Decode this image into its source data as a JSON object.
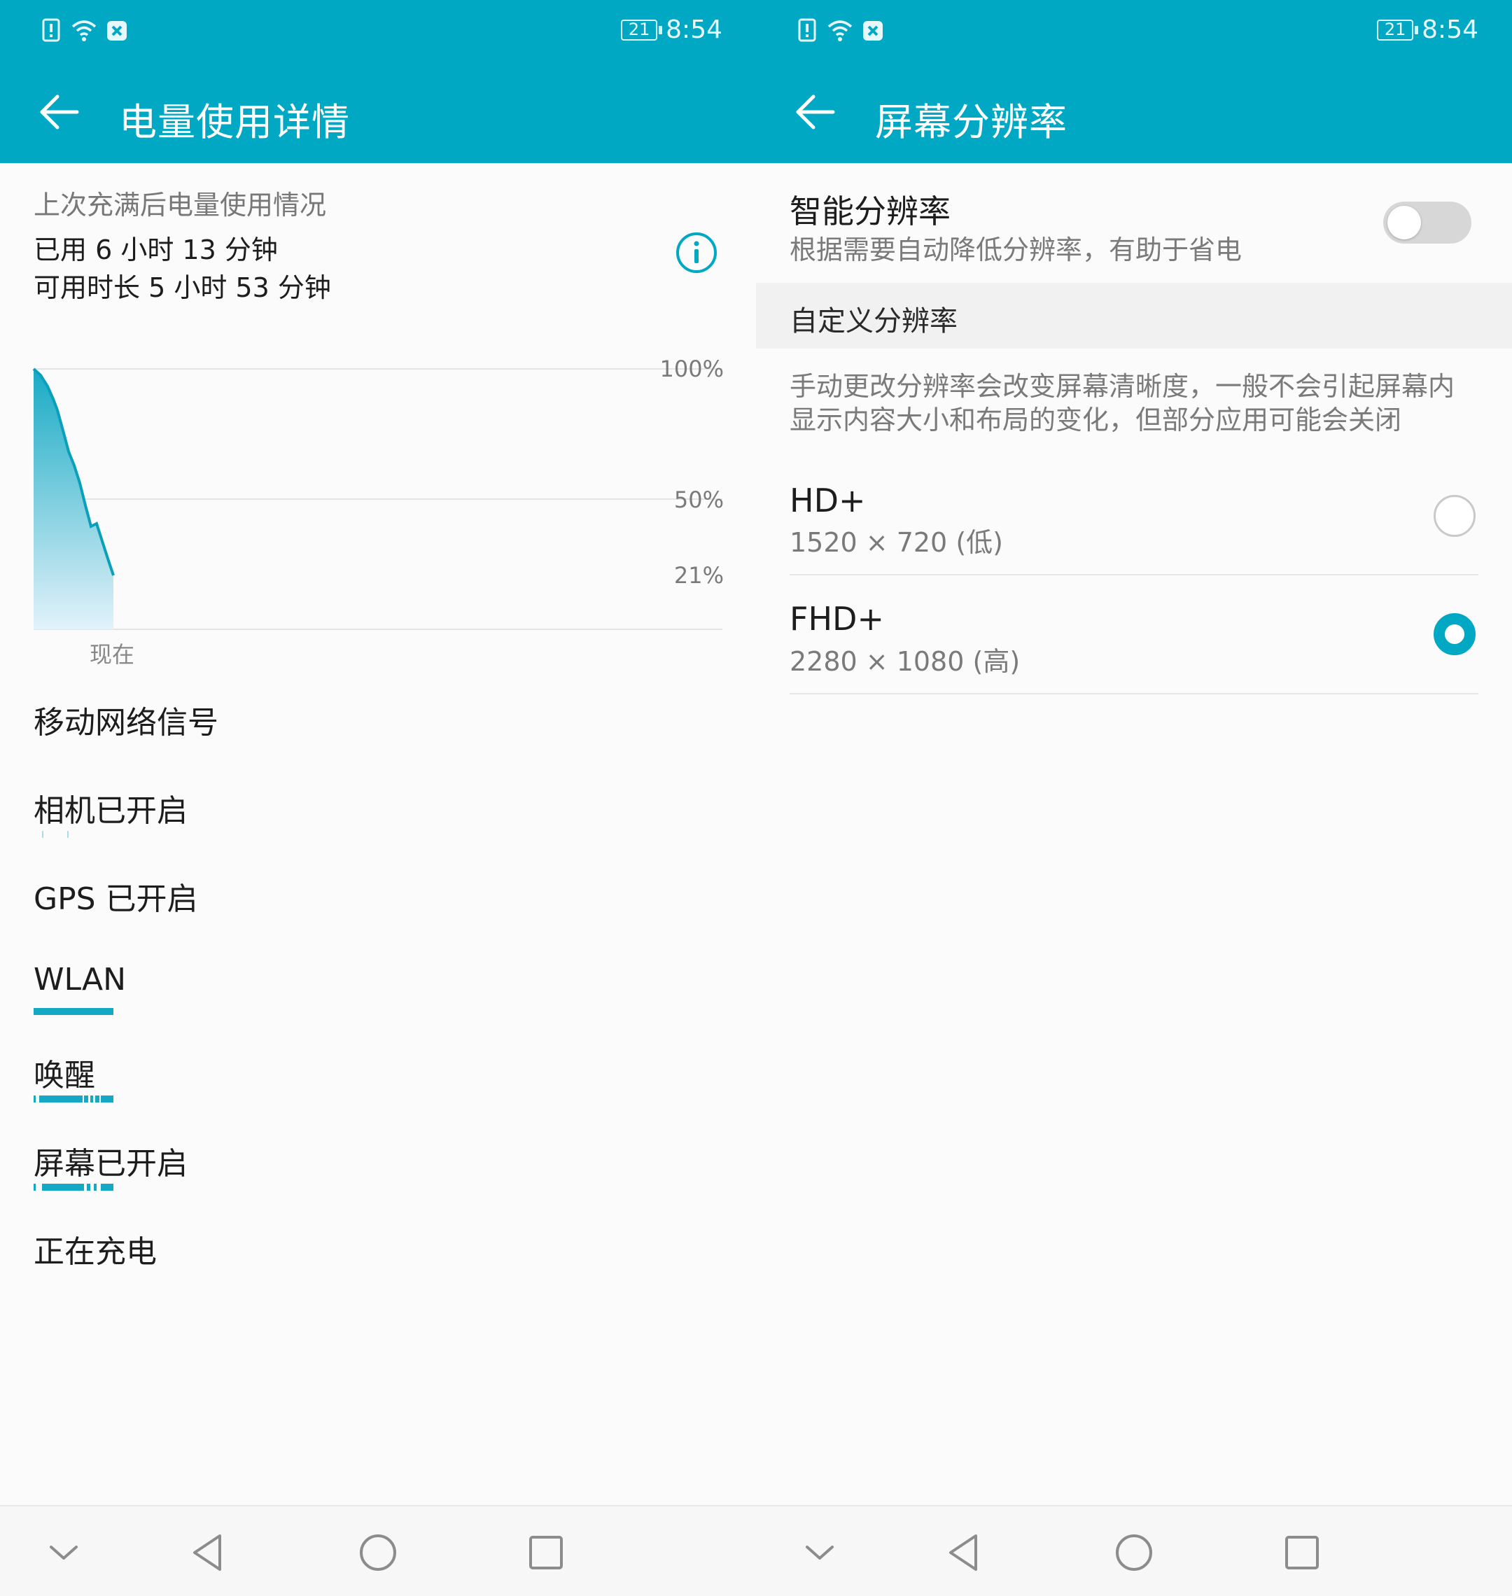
{
  "status_bar": {
    "time": "8:54",
    "battery": "21"
  },
  "left": {
    "title": "电量使用详情",
    "caption": "上次充满后电量使用情况",
    "used": "已用 6 小时 13 分钟",
    "available": "可用时长 5 小时 53 分钟",
    "chart_labels": {
      "p100": "100%",
      "p50": "50%",
      "p21": "21%",
      "now": "现在"
    },
    "categories": [
      {
        "label": "移动网络信号"
      },
      {
        "label": "相机已开启"
      },
      {
        "label": "GPS 已开启"
      },
      {
        "label": "WLAN"
      },
      {
        "label": "唤醒"
      },
      {
        "label": "屏幕已开启"
      },
      {
        "label": "正在充电"
      }
    ]
  },
  "right": {
    "title": "屏幕分辨率",
    "smart": {
      "title": "智能分辨率",
      "subtitle": "根据需要自动降低分辨率，有助于省电",
      "enabled": false
    },
    "section": "自定义分辨率",
    "description": "手动更改分辨率会改变屏幕清晰度，一般不会引起屏幕内显示内容大小和布局的变化，但部分应用可能会关闭",
    "options": [
      {
        "title": "HD+",
        "subtitle": "1520 × 720 (低)",
        "selected": false
      },
      {
        "title": "FHD+",
        "subtitle": "2280 × 1080 (高)",
        "selected": true
      }
    ]
  },
  "colors": {
    "accent": "#00a8c4",
    "background": "#fbfbfb"
  },
  "icons": [
    "back-arrow-icon",
    "info-icon",
    "sim-alert-icon",
    "wifi-icon",
    "app-notification-icon",
    "battery-icon",
    "collapse-icon",
    "back-triangle-icon",
    "home-circle-icon",
    "recents-square-icon"
  ]
}
